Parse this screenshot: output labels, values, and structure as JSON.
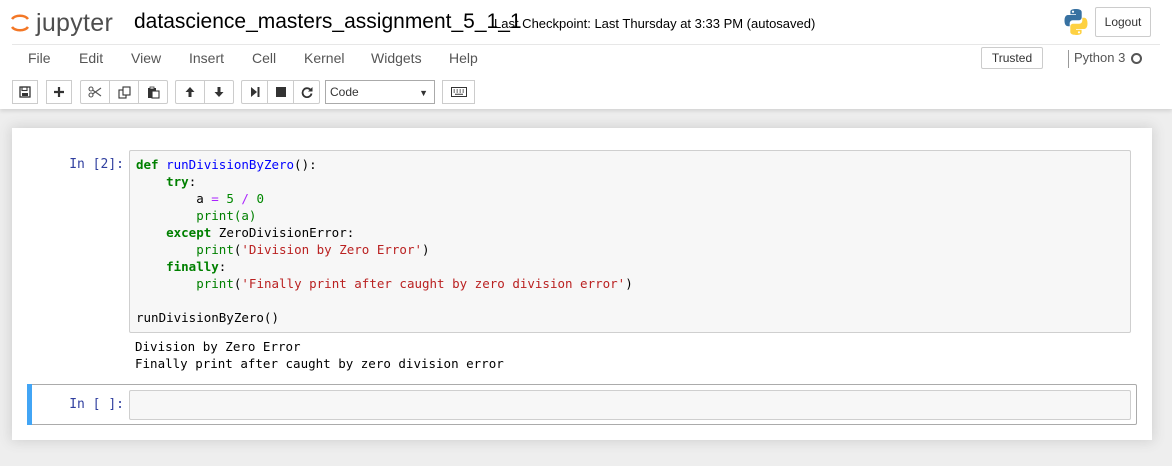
{
  "header": {
    "logo_text": "jupyter",
    "notebook_name": "datascience_masters_assignment_5_1_1",
    "checkpoint": "Last Checkpoint: Last Thursday at 3:33 PM (autosaved)",
    "logout_label": "Logout"
  },
  "menu": {
    "items": [
      "File",
      "Edit",
      "View",
      "Insert",
      "Cell",
      "Kernel",
      "Widgets",
      "Help"
    ],
    "trusted_label": "Trusted",
    "kernel_name": "Python 3"
  },
  "toolbar": {
    "icons": [
      "save-icon",
      "plus-icon",
      "cut-icon",
      "copy-icon",
      "paste-icon",
      "arrow-up-icon",
      "arrow-down-icon",
      "step-forward-icon",
      "stop-icon",
      "restart-icon",
      "keyboard-icon"
    ],
    "cell_type": "Code"
  },
  "cells": [
    {
      "prompt": "In [2]:",
      "code_lines": [
        [
          {
            "t": "def",
            "c": "kw"
          },
          {
            "t": " ",
            "c": ""
          },
          {
            "t": "runDivisionByZero",
            "c": "fn"
          },
          {
            "t": "():",
            "c": "br"
          }
        ],
        [
          {
            "t": "    ",
            "c": ""
          },
          {
            "t": "try",
            "c": "kw"
          },
          {
            "t": ":",
            "c": ""
          }
        ],
        [
          {
            "t": "        a ",
            "c": ""
          },
          {
            "t": "=",
            "c": "op"
          },
          {
            "t": " ",
            "c": ""
          },
          {
            "t": "5",
            "c": "num"
          },
          {
            "t": " ",
            "c": ""
          },
          {
            "t": "/",
            "c": "op"
          },
          {
            "t": " ",
            "c": ""
          },
          {
            "t": "0",
            "c": "num"
          }
        ],
        [
          {
            "t": "        ",
            "c": ""
          },
          {
            "t": "print",
            "c": "brg"
          },
          {
            "t": "(a)",
            "c": "brg"
          }
        ],
        [
          {
            "t": "    ",
            "c": ""
          },
          {
            "t": "except",
            "c": "kw"
          },
          {
            "t": " ZeroDivisionError:",
            "c": ""
          }
        ],
        [
          {
            "t": "        ",
            "c": ""
          },
          {
            "t": "print",
            "c": "brg"
          },
          {
            "t": "(",
            "c": "br"
          },
          {
            "t": "'Division by Zero Error'",
            "c": "str"
          },
          {
            "t": ")",
            "c": "br"
          }
        ],
        [
          {
            "t": "    ",
            "c": ""
          },
          {
            "t": "finally",
            "c": "kw"
          },
          {
            "t": ":",
            "c": ""
          }
        ],
        [
          {
            "t": "        ",
            "c": ""
          },
          {
            "t": "print",
            "c": "brg"
          },
          {
            "t": "(",
            "c": "br"
          },
          {
            "t": "'Finally print after caught by zero division error'",
            "c": "str"
          },
          {
            "t": ")",
            "c": "br"
          }
        ],
        [
          {
            "t": "",
            "c": ""
          }
        ],
        [
          {
            "t": "runDivisionByZero()",
            "c": ""
          }
        ]
      ],
      "output": "Division by Zero Error\nFinally print after caught by zero division error"
    },
    {
      "prompt": "In [ ]:",
      "code_lines": [],
      "output": ""
    }
  ]
}
